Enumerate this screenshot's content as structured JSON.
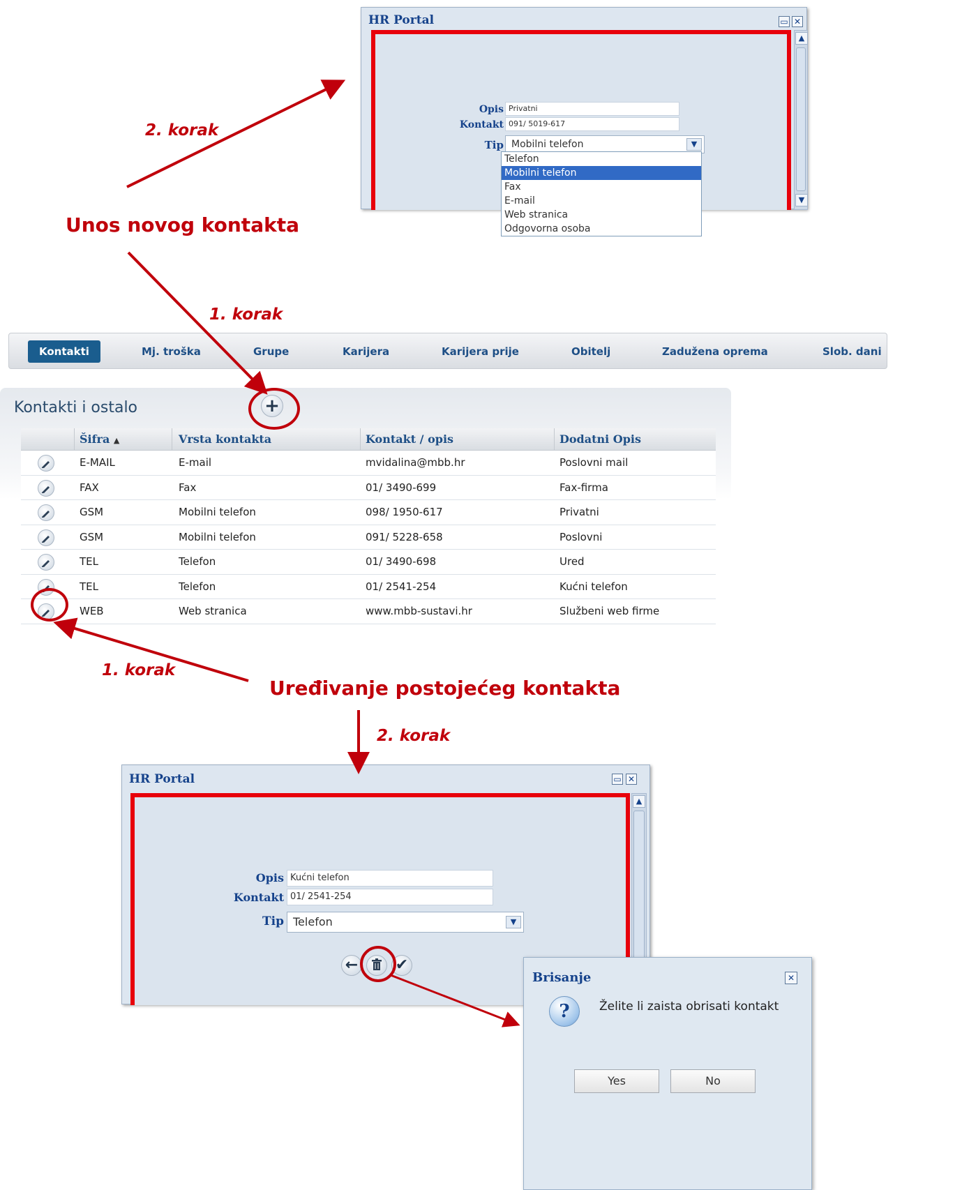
{
  "annotations": {
    "new_contact_heading": "Unos novog kontakta",
    "edit_contact_heading": "Uređivanje postojećeg kontakta",
    "step2_top": "2. korak",
    "step1_top": "1. korak",
    "step1_bottom": "1. korak",
    "step2_bottom": "2. korak"
  },
  "top_dialog": {
    "title": "HR Portal",
    "opis_label": "Opis",
    "opis_value": "Privatni",
    "kontakt_label": "Kontakt",
    "kontakt_value": "091/ 5019-617",
    "tip_label": "Tip",
    "tip_value": "Mobilni telefon",
    "options": [
      "Telefon",
      "Mobilni telefon",
      "Fax",
      "E-mail",
      "Web stranica",
      "Odgovorna osoba"
    ],
    "selected_option": "Mobilni telefon"
  },
  "tabs": [
    "Kontakti",
    "Mj. troška",
    "Grupe",
    "Karijera",
    "Karijera prije",
    "Obitelj",
    "Zadužena oprema",
    "Slob. dani"
  ],
  "active_tab": "Kontakti",
  "panel": {
    "title": "Kontakti i ostalo",
    "add_icon": "plus-icon"
  },
  "grid": {
    "columns": [
      "Šifra",
      "Vrsta kontakta",
      "Kontakt / opis",
      "Dodatni Opis"
    ],
    "sort_indicator": "▲",
    "rows": [
      [
        "E-MAIL",
        "E-mail",
        "mvidalina@mbb.hr",
        "Poslovni mail"
      ],
      [
        "FAX",
        "Fax",
        "01/ 3490-699",
        "Fax-firma"
      ],
      [
        "GSM",
        "Mobilni telefon",
        "098/ 1950-617",
        "Privatni"
      ],
      [
        "GSM",
        "Mobilni telefon",
        "091/ 5228-658",
        "Poslovni"
      ],
      [
        "TEL",
        "Telefon",
        "01/ 3490-698",
        "Ured"
      ],
      [
        "TEL",
        "Telefon",
        "01/ 2541-254",
        "Kućni telefon"
      ],
      [
        "WEB",
        "Web stranica",
        "www.mbb-sustavi.hr",
        "Službeni web firme"
      ]
    ]
  },
  "bottom_dialog": {
    "title": "HR Portal",
    "opis_label": "Opis",
    "opis_value": "Kućni telefon",
    "kontakt_label": "Kontakt",
    "kontakt_value": "01/ 2541-254",
    "tip_label": "Tip",
    "tip_value": "Telefon"
  },
  "confirm_dialog": {
    "title": "Brisanje",
    "message": "Želite li zaista obrisati kontakt",
    "yes_label": "Yes",
    "no_label": "No"
  },
  "colors": {
    "annotation_red": "#c0000b",
    "frame_red": "#e8000b",
    "tab_active": "#1a5d8e",
    "title_blue": "#15428b"
  }
}
